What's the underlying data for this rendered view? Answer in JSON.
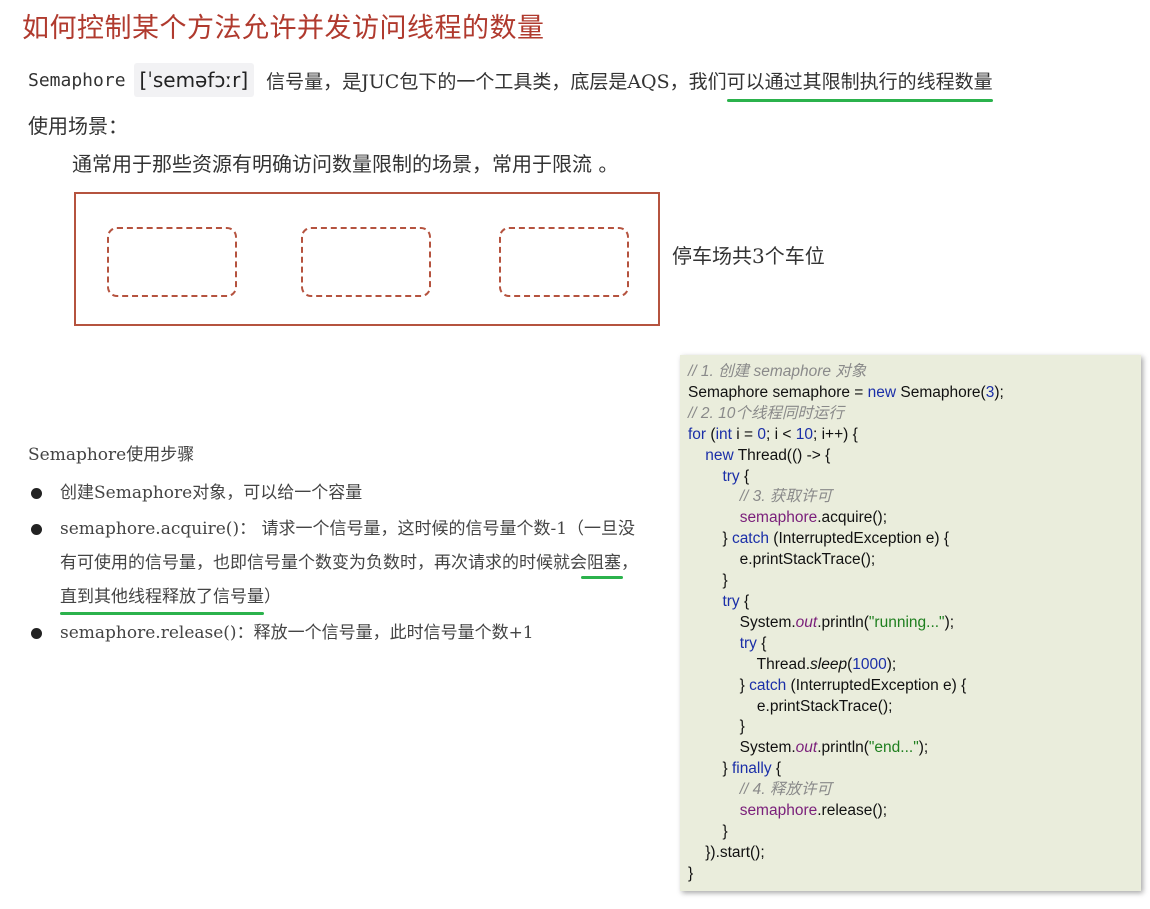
{
  "title": "如何控制某个方法允许并发访问线程的数量",
  "intro": {
    "term": "Semaphore",
    "phonetic": "[ˈseməfɔːr]",
    "text": "信号量，是JUC包下的一个工具类，底层是AQS，我们",
    "highlight": "可以通过其限制执行的线程数量"
  },
  "usage": {
    "label": "使用场景：",
    "text": "通常用于那些资源有明确访问数量限制的场景，常用于限流 。"
  },
  "parking": {
    "label": "停车场共3个车位",
    "slots": 3
  },
  "steps": {
    "title": "Semaphore使用步骤",
    "items": [
      {
        "text": "创建Semaphore对象，可以给一个容量"
      },
      {
        "text_before": "semaphore.acquire()： 请求一个信号量，这时候的信号量个数-1（一旦没有可使用的信号量，也即信号量个数变为负数时，再次请求的时候就会",
        "u1": "阻塞",
        "mid": "，",
        "u2": "直到其他线程释放了信号量",
        "text_after": "）"
      },
      {
        "text": "semaphore.release()：释放一个信号量，此时信号量个数+1"
      }
    ]
  },
  "code": {
    "c1": "// 1. 创建 semaphore 对象",
    "c2": "// 2. 10个线程同时运行",
    "c3": "// 3. 获取许可",
    "c4": "// 4. 释放许可",
    "running": "\"running...\"",
    "end": "\"end...\"",
    "permits": "3",
    "loop_start": "0",
    "loop_end": "10",
    "sleep": "1000"
  }
}
